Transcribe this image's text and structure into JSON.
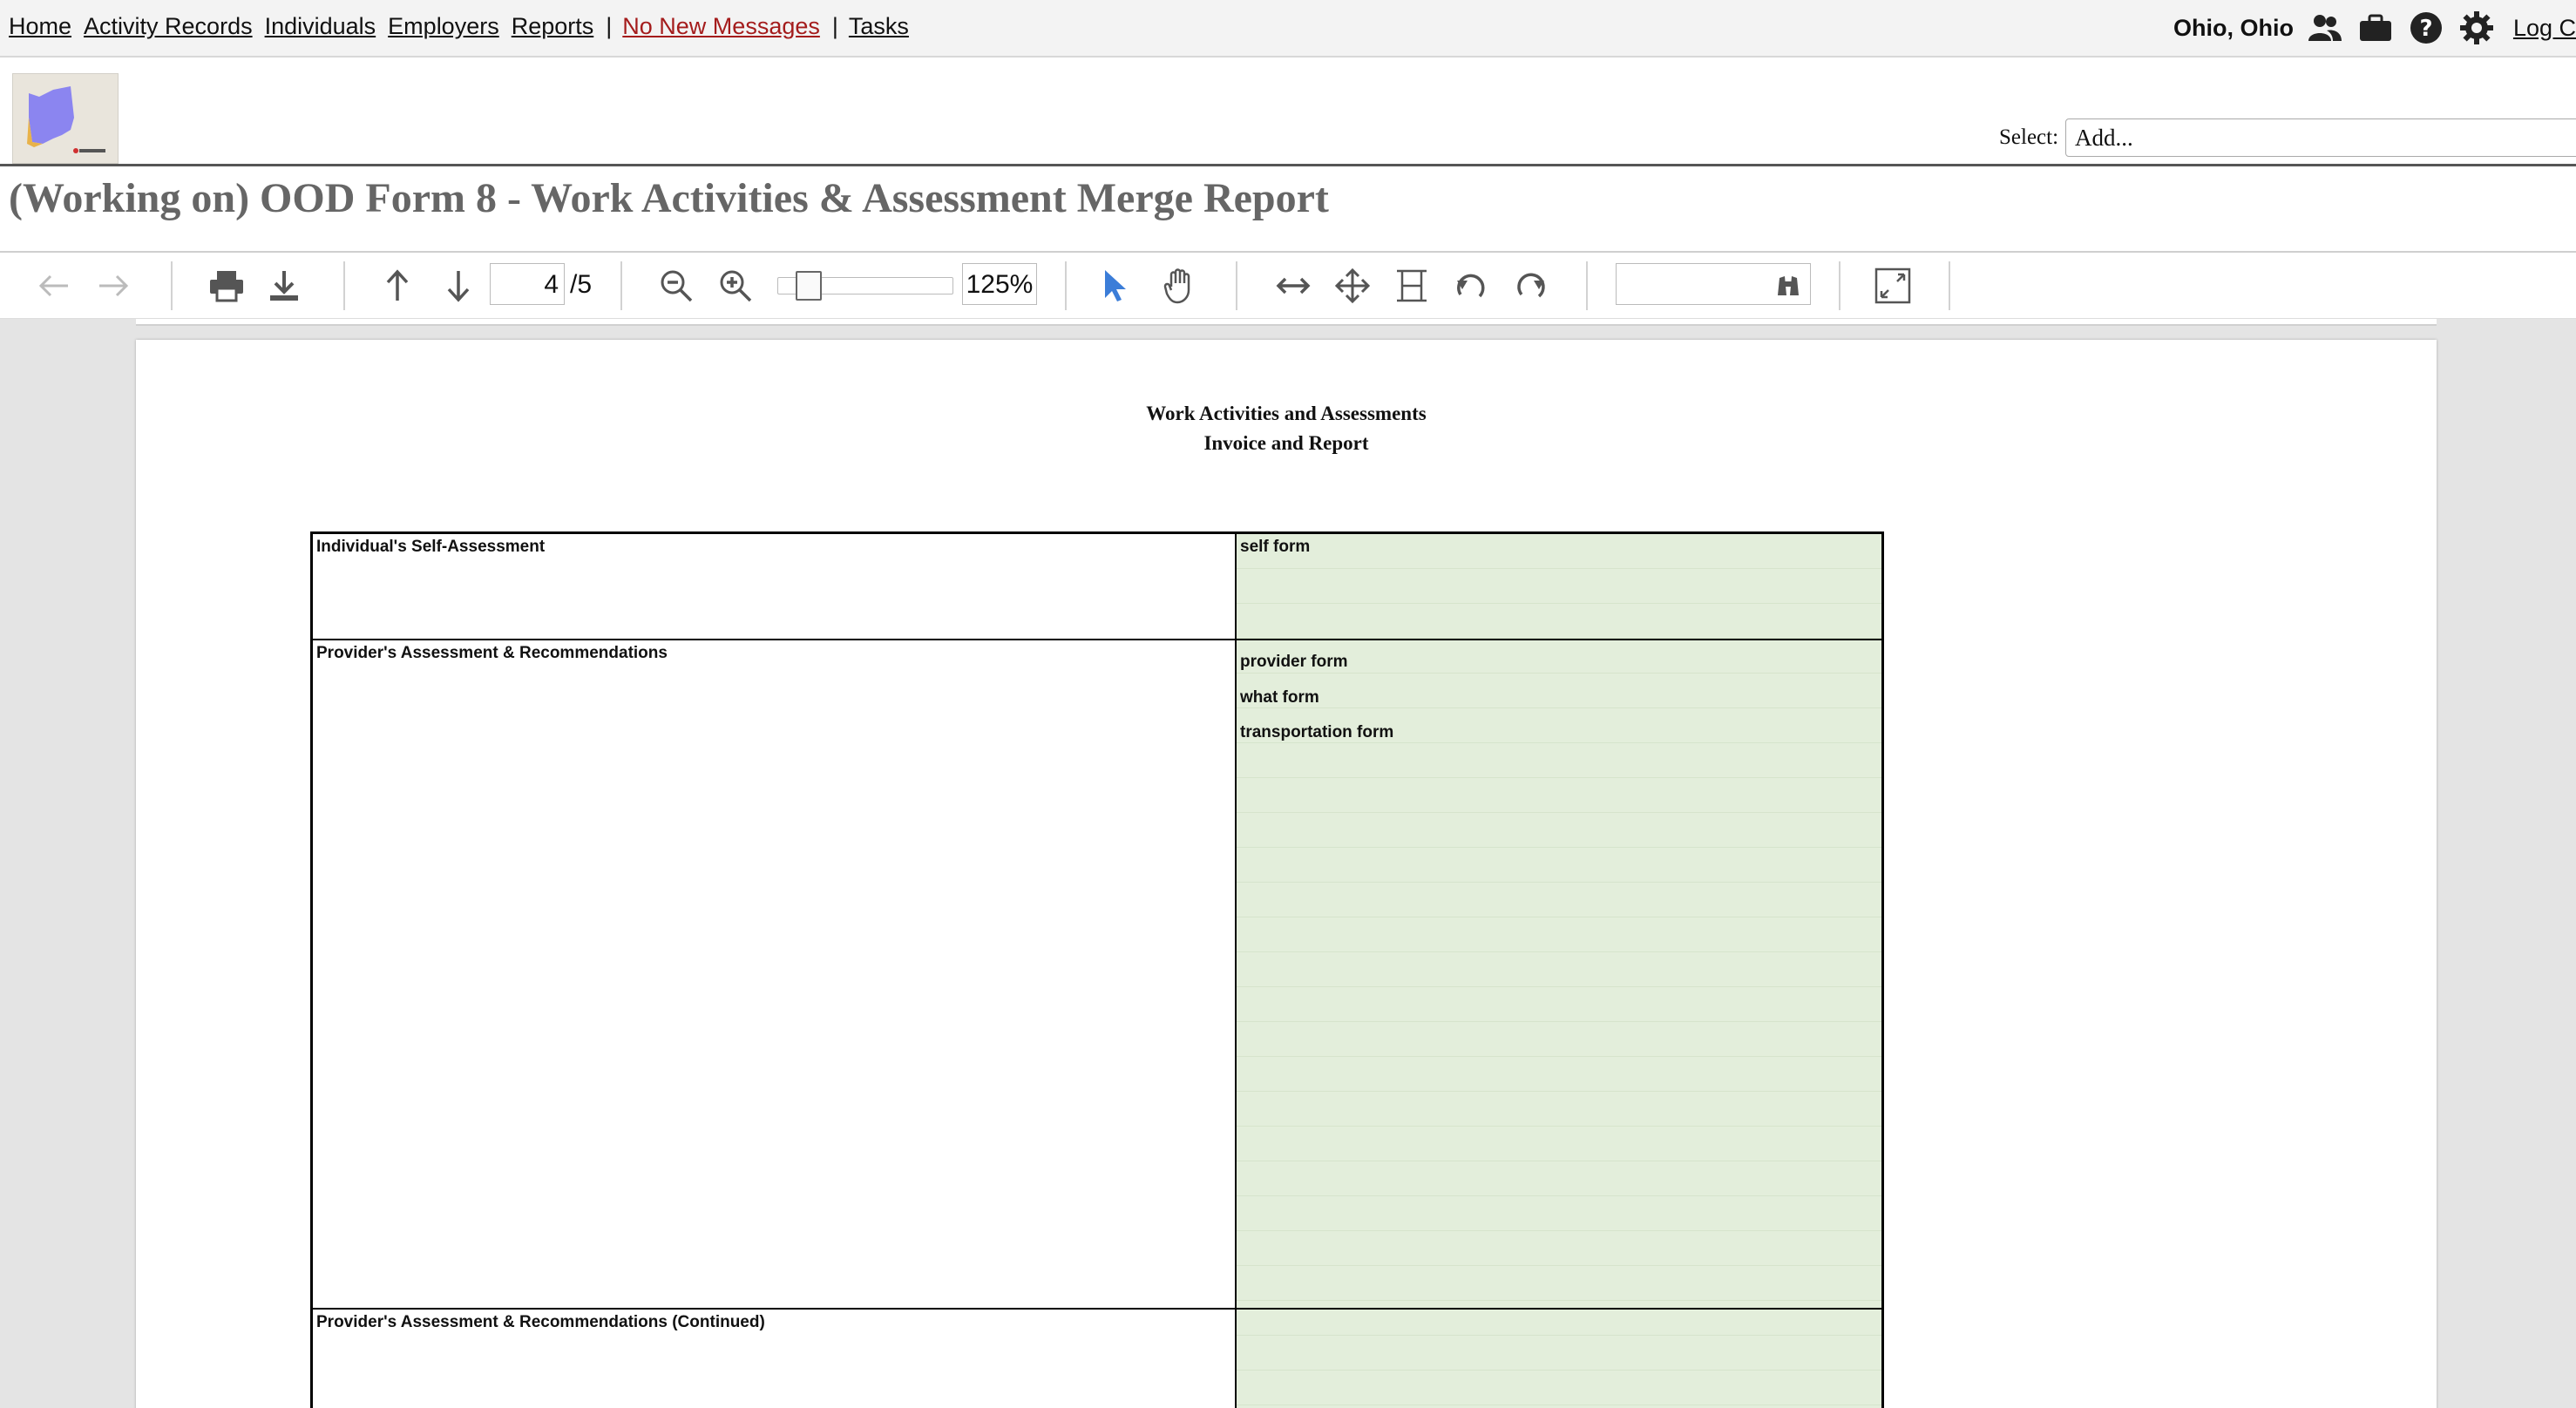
{
  "nav": {
    "links": {
      "home": "Home",
      "activity_records": "Activity Records",
      "individuals": "Individuals",
      "employers": "Employers",
      "reports": "Reports",
      "messages": "No New Messages",
      "tasks": "Tasks"
    },
    "separator": "|",
    "user": "Ohio, Ohio",
    "logout": "Log C",
    "icons": [
      "users-icon",
      "briefcase-icon",
      "help-icon",
      "settings-icon"
    ],
    "messages_color": "#a41c1c"
  },
  "header": {
    "select_label": "Select:",
    "select_value": "Add..."
  },
  "page_title": "(Working on) OOD Form 8 - Work Activities & Assessment Merge Report",
  "viewer": {
    "current_page": "4",
    "total_pages": "/5",
    "zoom": "125%",
    "zoom_slider_value": 0.12,
    "search_value": ""
  },
  "document": {
    "heading_line1": "Work Activities and Assessments",
    "heading_line2": "Invoice and Report",
    "rows": [
      {
        "label": "Individual's Self-Assessment",
        "fields": [
          "self form"
        ]
      },
      {
        "label": "Provider's Assessment & Recommendations",
        "fields": [
          "provider form",
          "what form",
          "transportation form"
        ]
      },
      {
        "label": "Provider's Assessment & Recommendations (Continued)",
        "fields": []
      }
    ],
    "field_fill_color": "#e3eedb"
  }
}
